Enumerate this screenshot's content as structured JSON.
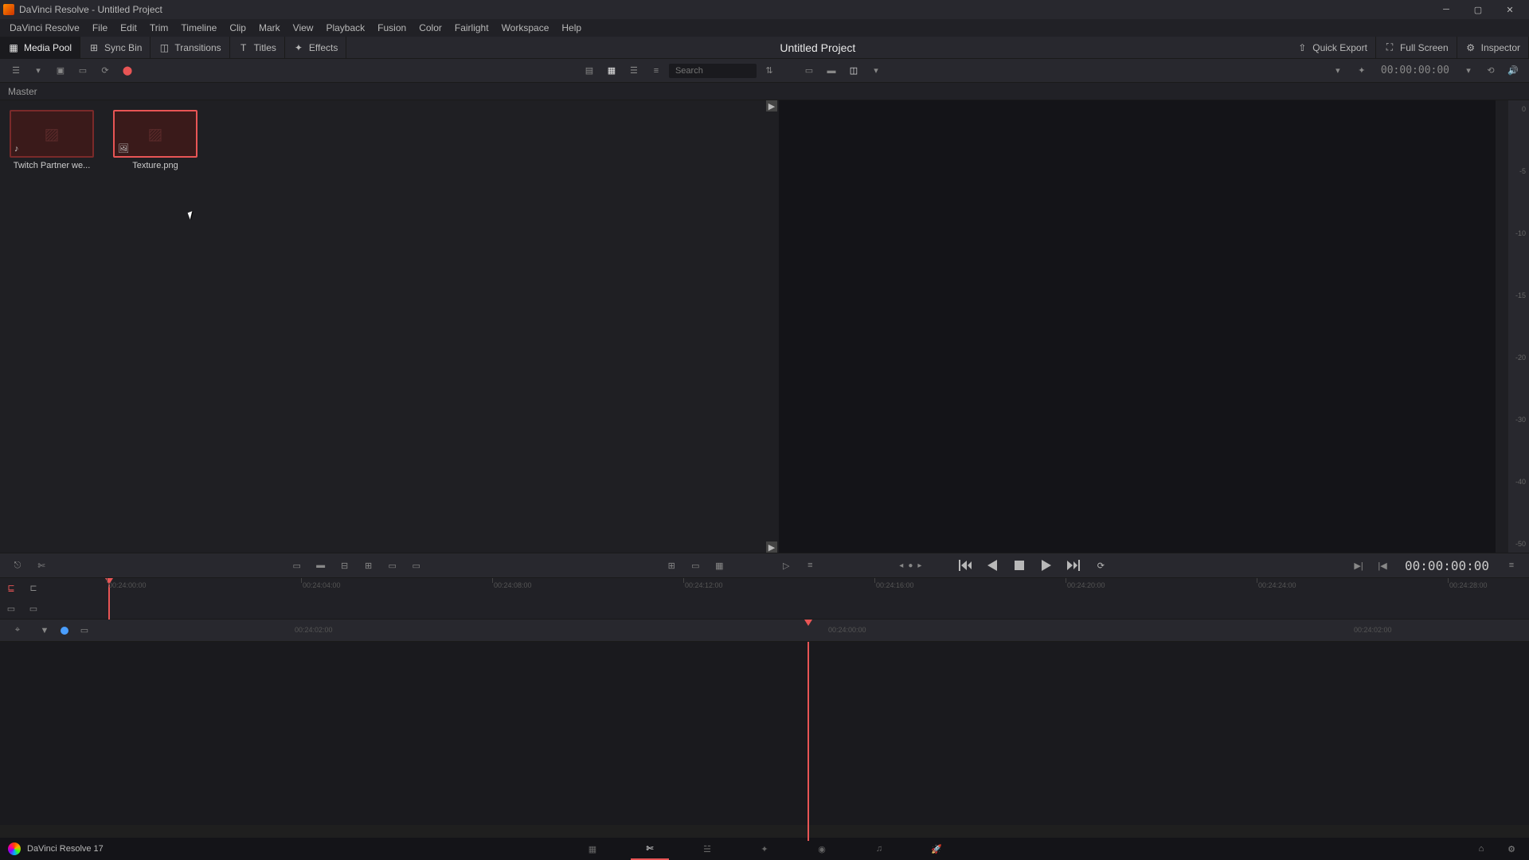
{
  "titlebar": {
    "title": "DaVinci Resolve - Untitled Project"
  },
  "menu": [
    "DaVinci Resolve",
    "File",
    "Edit",
    "Trim",
    "Timeline",
    "Clip",
    "Mark",
    "View",
    "Playback",
    "Fusion",
    "Color",
    "Fairlight",
    "Workspace",
    "Help"
  ],
  "toolbar": {
    "media_pool": "Media Pool",
    "sync_bin": "Sync Bin",
    "transitions": "Transitions",
    "titles": "Titles",
    "effects": "Effects",
    "project": "Untitled Project",
    "quick_export": "Quick Export",
    "full_screen": "Full Screen",
    "inspector": "Inspector"
  },
  "search": {
    "placeholder": "Search"
  },
  "timecode_small": "00:00:00:00",
  "breadcrumb": "Master",
  "clips": [
    {
      "label": "Twitch Partner we...",
      "type": "audio"
    },
    {
      "label": "Texture.png",
      "type": "image"
    }
  ],
  "meter_ticks": [
    "0",
    "-5",
    "-10",
    "-15",
    "-20",
    "-30",
    "-40",
    "-50"
  ],
  "timecode_large": "00:00:00:00",
  "ruler1_ticks": [
    {
      "pos": 46,
      "label": "00:24:00:00"
    },
    {
      "pos": 290,
      "label": "00:24:04:00"
    },
    {
      "pos": 530,
      "label": "00:24:08:00"
    },
    {
      "pos": 770,
      "label": "00:24:12:00"
    },
    {
      "pos": 1010,
      "label": "00:24:16:00"
    },
    {
      "pos": 1250,
      "label": "00:24:20:00"
    },
    {
      "pos": 1490,
      "label": "00:24:24:00"
    },
    {
      "pos": 1730,
      "label": "00:24:28:00"
    }
  ],
  "ruler2_ticks": [
    {
      "pos": 240,
      "label": "00:24:02:00"
    },
    {
      "pos": 910,
      "label": "00:24:00:00"
    },
    {
      "pos": 1570,
      "label": "00:24:02:00"
    }
  ],
  "statusbar": {
    "version": "DaVinci Resolve 17"
  },
  "pages": [
    "media",
    "cut",
    "edit",
    "fusion",
    "color",
    "fairlight",
    "deliver"
  ]
}
